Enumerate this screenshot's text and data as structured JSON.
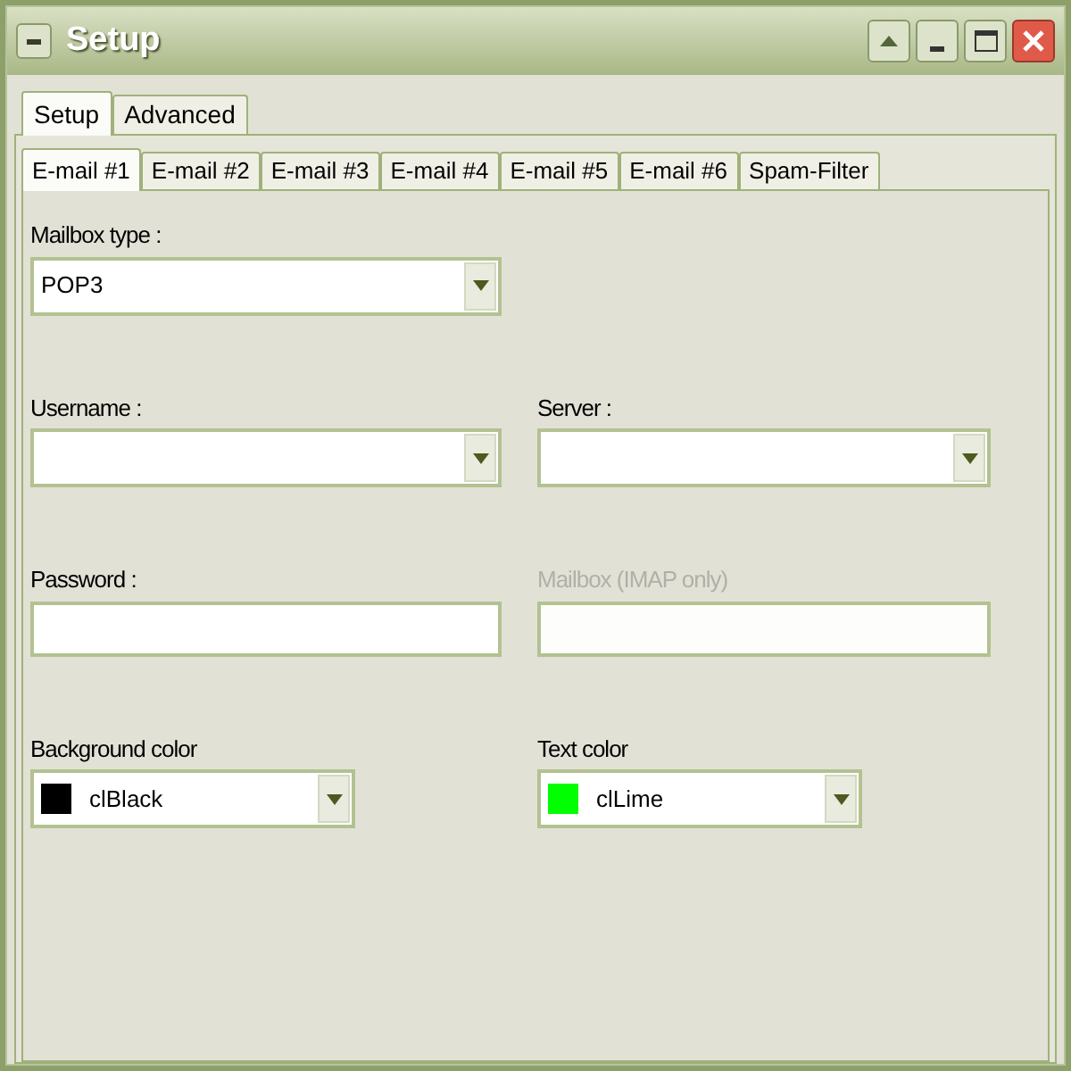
{
  "window": {
    "title": "Setup"
  },
  "tabs": [
    {
      "label": "Setup",
      "selected": true
    },
    {
      "label": "Advanced",
      "selected": false
    }
  ],
  "subtabs": [
    {
      "label": "E-mail #1",
      "selected": true
    },
    {
      "label": "E-mail #2",
      "selected": false
    },
    {
      "label": "E-mail #3",
      "selected": false
    },
    {
      "label": "E-mail #4",
      "selected": false
    },
    {
      "label": "E-mail #5",
      "selected": false
    },
    {
      "label": "E-mail #6",
      "selected": false
    },
    {
      "label": "Spam-Filter",
      "selected": false
    }
  ],
  "rows": [
    {
      "fields": [
        {
          "kind": "combo",
          "label": "Mailbox type :",
          "value": "POP3",
          "disabled": false
        }
      ]
    },
    {
      "fields": [
        {
          "kind": "combo",
          "label": "Username :",
          "disabled": false
        },
        {
          "kind": "combo",
          "label": "Server :",
          "disabled": false
        }
      ]
    },
    {
      "fields": [
        {
          "kind": "text",
          "label": "Password :",
          "disabled": false
        },
        {
          "kind": "text",
          "label": "Mailbox (IMAP only)",
          "disabled": true
        }
      ]
    },
    {
      "fields": [
        {
          "kind": "color",
          "label": "Background color",
          "value": "clBlack",
          "color": "#000000",
          "disabled": false
        },
        {
          "kind": "color",
          "label": "Text color",
          "value": "clLime",
          "color": "#00ff00",
          "disabled": false
        }
      ]
    }
  ]
}
